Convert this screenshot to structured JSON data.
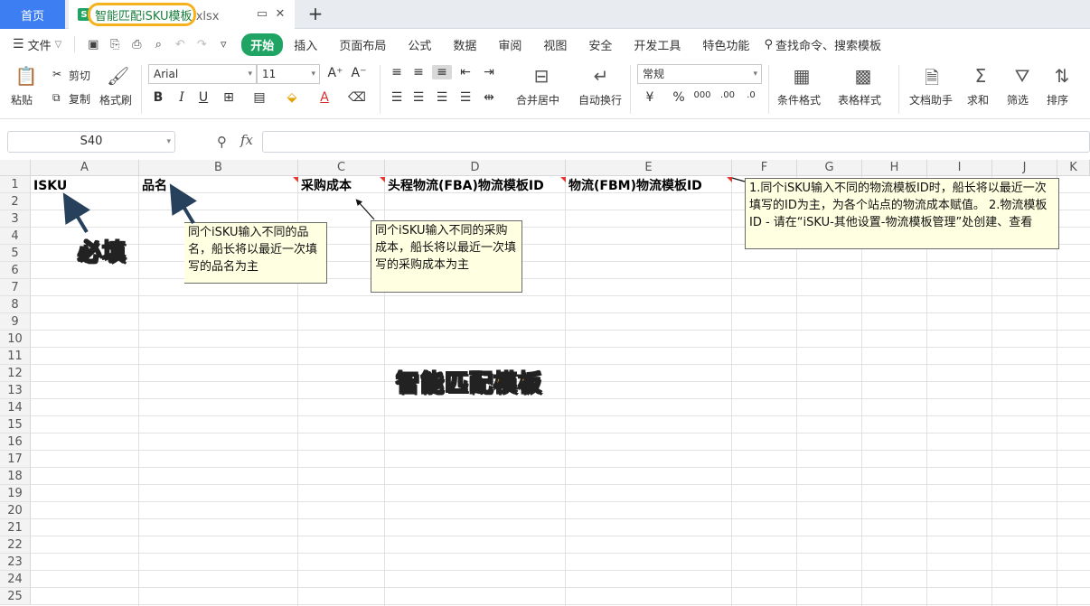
{
  "tabs": {
    "home": "首页",
    "file_icon": "S",
    "file_name": "智能匹配iSKU模板",
    "file_ext": ".xlsx",
    "new_tab": "+"
  },
  "menu": {
    "file": "文件",
    "items": [
      "开始",
      "插入",
      "页面布局",
      "公式",
      "数据",
      "审阅",
      "视图",
      "安全",
      "开发工具",
      "特色功能"
    ],
    "search": "查找命令、搜索模板"
  },
  "ribbon": {
    "paste": "粘贴",
    "cut": "剪切",
    "copy": "复制",
    "format_painter": "格式刷",
    "font_name": "Arial",
    "font_size": "11",
    "merge_center": "合并居中",
    "wrap_text": "自动换行",
    "number_format": "常规",
    "conditional_format": "条件格式",
    "table_style": "表格样式",
    "doc_helper": "文档助手",
    "sum": "求和",
    "filter": "筛选",
    "sort": "排序"
  },
  "formula_bar": {
    "name_box": "S40",
    "fx": "fx",
    "value": ""
  },
  "grid": {
    "columns": [
      "A",
      "B",
      "C",
      "D",
      "E",
      "F",
      "G",
      "H",
      "I",
      "J",
      "K"
    ],
    "rows": [
      "1",
      "2",
      "3",
      "4",
      "5",
      "6",
      "7",
      "8",
      "9",
      "10",
      "11",
      "12",
      "13",
      "14",
      "15",
      "16",
      "17",
      "18",
      "19",
      "20",
      "21",
      "22",
      "23",
      "24",
      "25"
    ],
    "row1": [
      "ISKU",
      "品名",
      "采购成本",
      "头程物流(FBA)物流模板ID",
      "物流(FBM)物流模板ID"
    ]
  },
  "comments": {
    "name": "同个iSKU输入不同的品名，船长将以最近一次填写的品名为主",
    "cost": "同个iSKU输入不同的采购成本，船长将以最近一次填写的采购成本为主",
    "logistics": "1.同个iSKU输入不同的物流模板ID时，船长将以最近一次填写的ID为主，为各个站点的物流成本赋值。 2.物流模板ID - 请在“iSKU-其他设置-物流模板管理”处创建、查看"
  },
  "annotations": {
    "required": "必填",
    "template_title": "智能匹配模板"
  },
  "colors": {
    "accent": "#1fa463",
    "home_tab": "#3d7ef2",
    "highlight": "#f6b21c",
    "comment_bg": "#ffffe1"
  }
}
